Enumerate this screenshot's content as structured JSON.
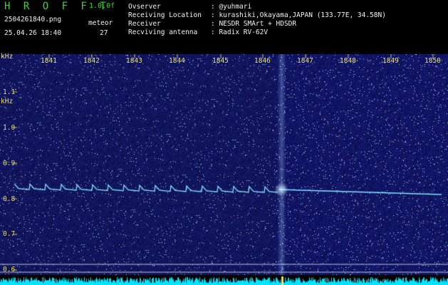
{
  "header": {
    "brand": "H R O F F T",
    "version": "1.0.0f",
    "filename": "2504261840.png",
    "datetime": "25.04.26 18:40",
    "meteor_label": "meteor",
    "meteor_count": "27"
  },
  "info": [
    {
      "label": "Ovserver",
      "value": ": @yuhmari"
    },
    {
      "label": "Receiving Location",
      "value": ": kurashiki,Okayama,JAPAN (133.77E, 34.58N)"
    },
    {
      "label": "Receiver",
      "value": ": NESDR SMArt + HDSDR"
    },
    {
      "label": "Recviving antenna",
      "value": ": Radix RV-62V"
    }
  ],
  "axis": {
    "unit_top": "kHz",
    "unit_bottom": "kHz",
    "y_ticks": [
      "1.1",
      "1.0",
      "0.9",
      "0.8",
      "0.7",
      "0.6"
    ],
    "time_ticks": [
      "1841",
      "1842",
      "1843",
      "1844",
      "1845",
      "1846",
      "1847",
      "1848",
      "1849",
      "1850"
    ]
  },
  "colors": {
    "background": "#000000",
    "spectrogram_dark": "#0a0f50",
    "spectrogram_bright": "#2a3aa0",
    "signal": "#7fe6ff",
    "baseline": "#00e5ff"
  }
}
